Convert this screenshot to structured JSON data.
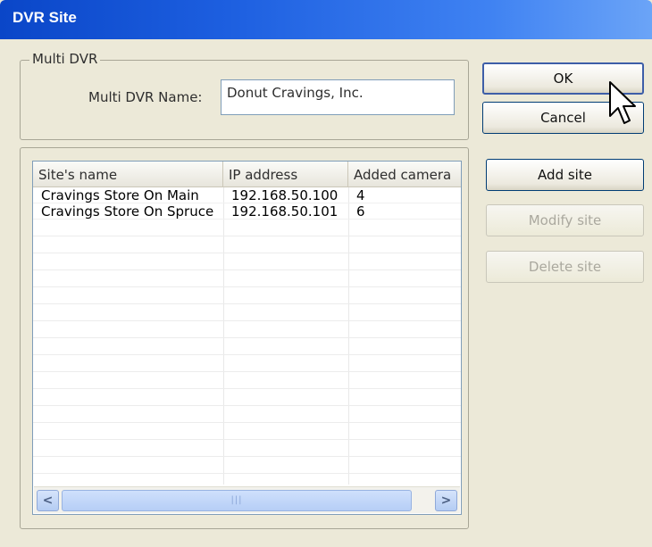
{
  "window": {
    "title": "DVR Site"
  },
  "multi_dvr": {
    "group_label": "Multi DVR",
    "name_label": "Multi DVR Name:",
    "name_value": "Donut Cravings, Inc."
  },
  "buttons": {
    "ok": "OK",
    "cancel": "Cancel",
    "add_site": "Add site",
    "modify_site": "Modify site",
    "delete_site": "Delete site"
  },
  "site_list": {
    "columns": [
      "Site's name",
      "IP address",
      "Added camera"
    ],
    "rows": [
      {
        "name": "Cravings Store On Main",
        "ip": "192.168.50.100",
        "cameras": "4"
      },
      {
        "name": "Cravings Store On Spruce",
        "ip": "192.168.50.101",
        "cameras": "6"
      }
    ]
  },
  "scrollbar": {
    "left_arrow": "<",
    "right_arrow": ">",
    "grip": "|||"
  },
  "icons": {
    "cursor": "pointer-cursor-icon"
  }
}
